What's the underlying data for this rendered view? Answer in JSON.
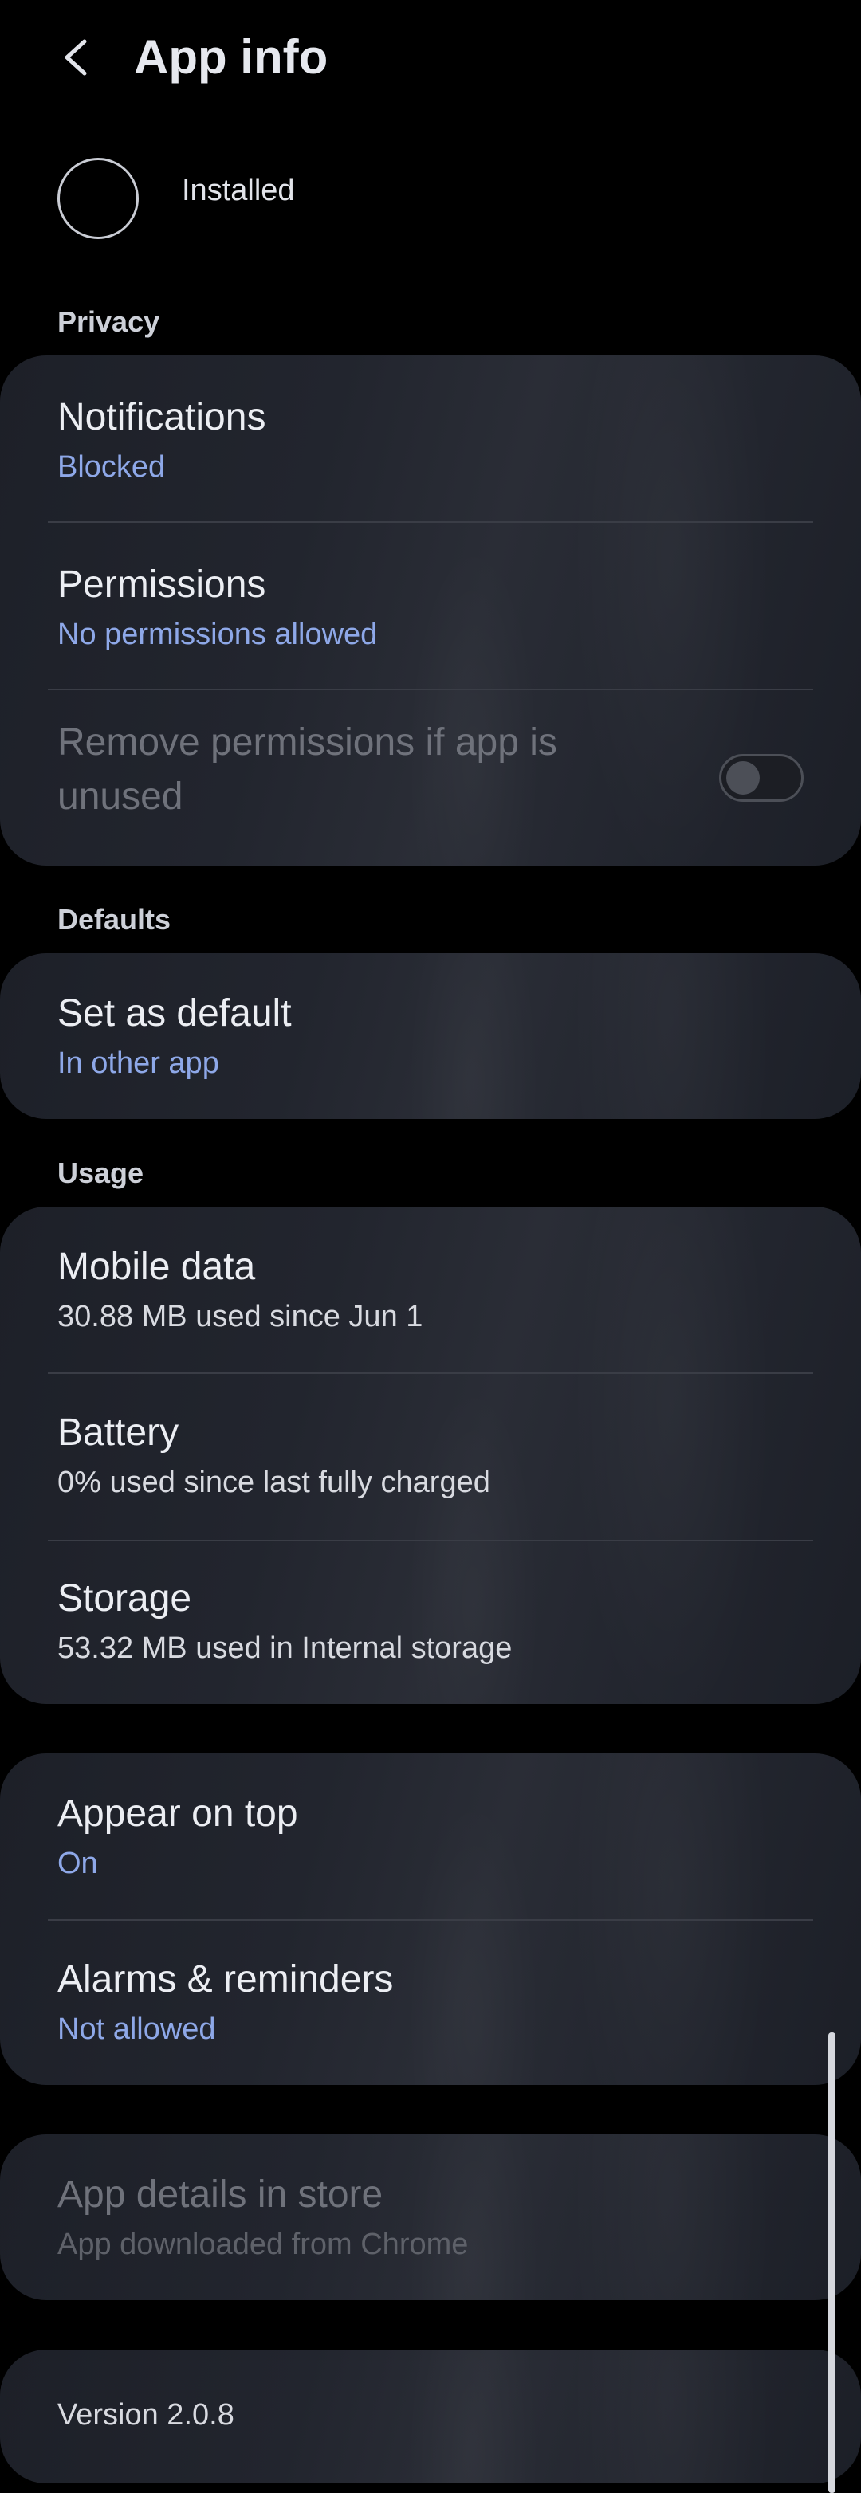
{
  "header": {
    "back_icon": "chevron-left-icon",
    "title": "App info"
  },
  "app": {
    "status": "Installed"
  },
  "sections": {
    "privacy": "Privacy",
    "defaults": "Defaults",
    "usage": "Usage"
  },
  "privacy": {
    "notifications": {
      "title": "Notifications",
      "value": "Blocked"
    },
    "permissions": {
      "title": "Permissions",
      "value": "No permissions allowed"
    },
    "remove_unused": {
      "title_line1": "Remove permissions if app is",
      "title_line2": "unused",
      "toggle_on": false
    }
  },
  "defaults": {
    "set_default": {
      "title": "Set as default",
      "value": "In other app"
    }
  },
  "usage": {
    "mobile_data": {
      "title": "Mobile data",
      "value": "30.88 MB used since Jun 1"
    },
    "battery": {
      "title": "Battery",
      "value": "0% used since last fully charged"
    },
    "storage": {
      "title": "Storage",
      "value": "53.32 MB used in Internal storage"
    }
  },
  "special": {
    "appear_on_top": {
      "title": "Appear on top",
      "value": "On"
    },
    "alarms": {
      "title": "Alarms & reminders",
      "value": "Not allowed"
    }
  },
  "store": {
    "title": "App details in store",
    "value": "App downloaded from Chrome"
  },
  "version": "Version 2.0.8",
  "colors": {
    "background": "#000000",
    "card": "#22252e",
    "accent_value": "#8ea8e8",
    "divider": "#3a3d46"
  }
}
